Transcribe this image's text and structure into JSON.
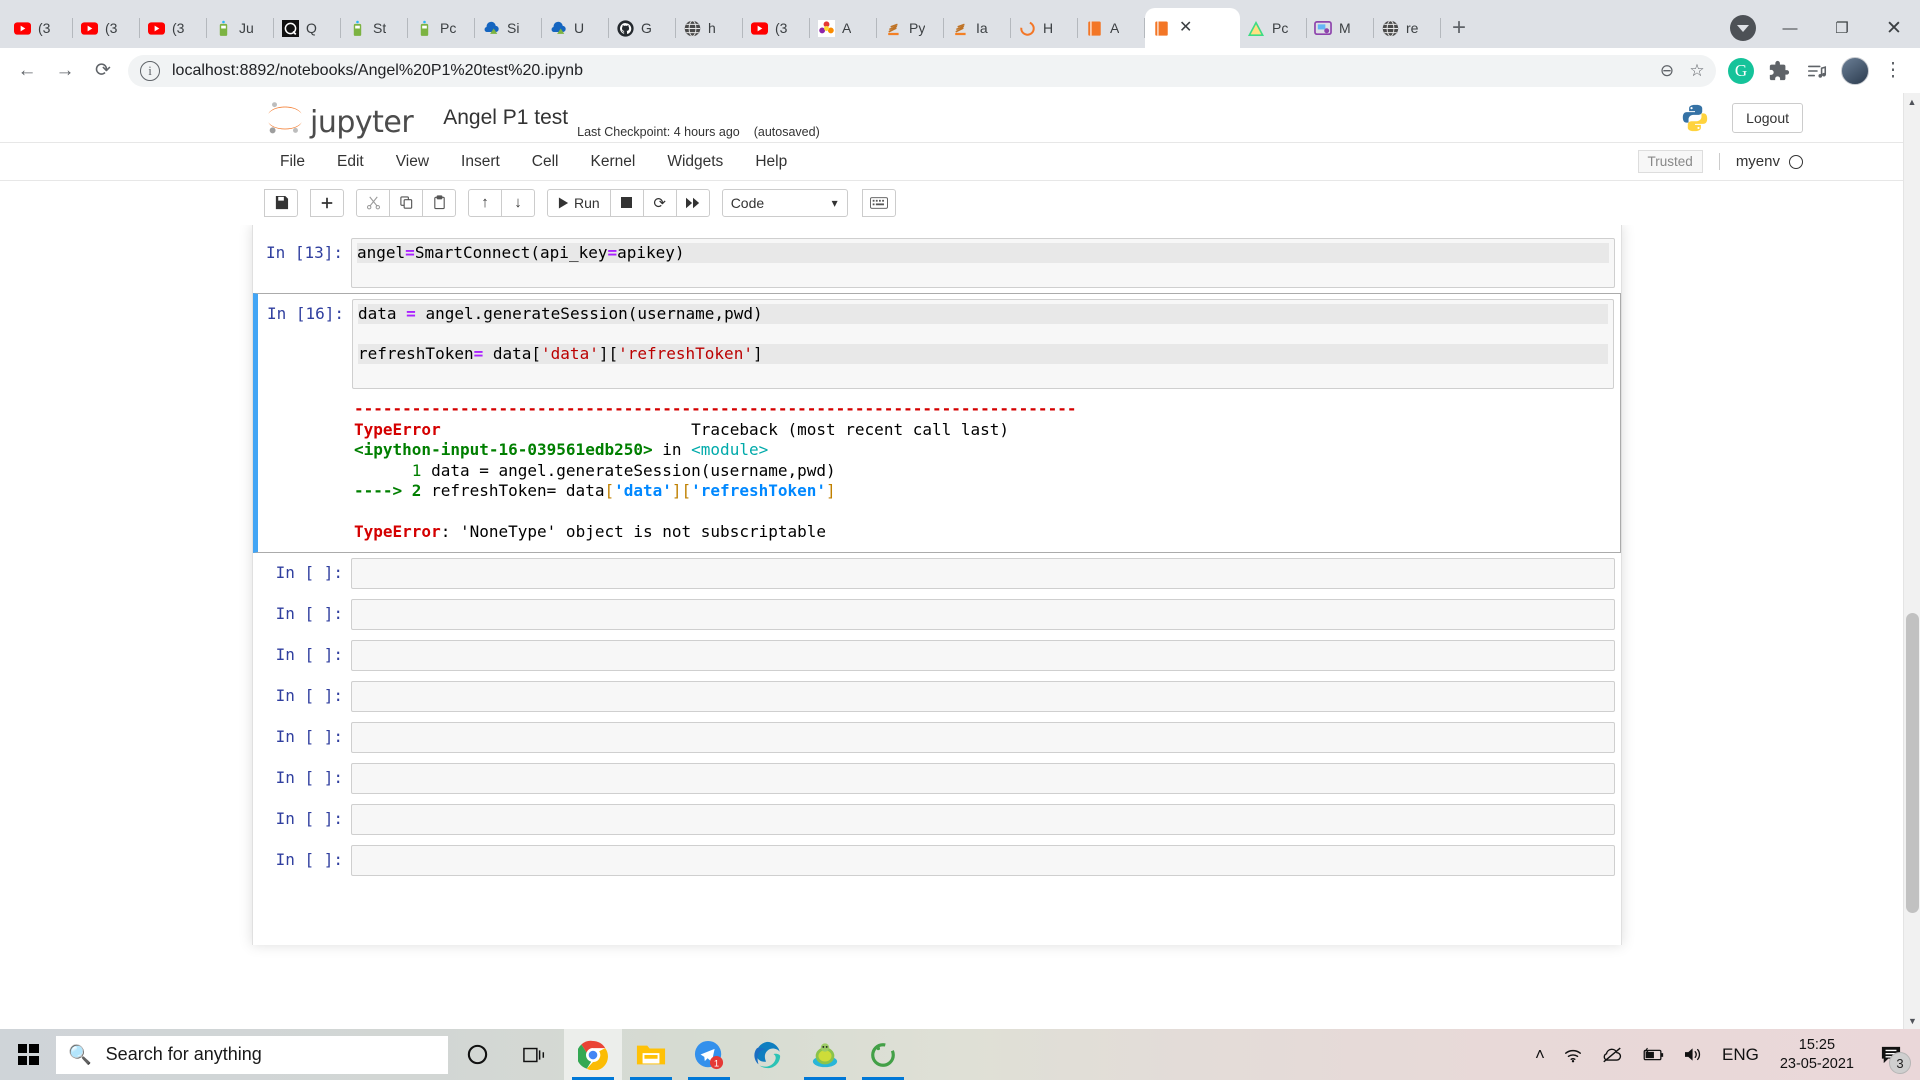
{
  "browser": {
    "tabs": [
      {
        "label": "(3",
        "icon": "youtube-icon",
        "type": "youtube",
        "active": false
      },
      {
        "label": "(3",
        "icon": "youtube-icon",
        "type": "youtube",
        "active": false
      },
      {
        "label": "(3",
        "icon": "youtube-icon",
        "type": "youtube",
        "active": false
      },
      {
        "label": "Ju",
        "icon": "jupyter-green-icon",
        "type": "green",
        "active": false
      },
      {
        "label": "Q",
        "icon": "dark-app-icon",
        "type": "dark",
        "active": false
      },
      {
        "label": "St",
        "icon": "jupyter-green-icon",
        "type": "green",
        "active": false
      },
      {
        "label": "Pc",
        "icon": "jupyter-green-icon",
        "type": "green",
        "active": false
      },
      {
        "label": "Si",
        "icon": "cloud-blue-icon",
        "type": "cloud",
        "active": false
      },
      {
        "label": "U",
        "icon": "cloud-blue-icon",
        "type": "cloud",
        "active": false
      },
      {
        "label": "G",
        "icon": "github-icon",
        "type": "github",
        "active": false
      },
      {
        "label": "h",
        "icon": "globe-icon",
        "type": "globe",
        "active": false
      },
      {
        "label": "(3",
        "icon": "youtube-icon",
        "type": "youtube",
        "active": false
      },
      {
        "label": "A",
        "icon": "flower-icon",
        "type": "flower",
        "active": false
      },
      {
        "label": "Py",
        "icon": "stack-orange-icon",
        "type": "stack",
        "active": false
      },
      {
        "label": "Ia",
        "icon": "stack-orange-icon",
        "type": "stack",
        "active": false
      },
      {
        "label": "H",
        "icon": "jupyter-ring-icon",
        "type": "ring",
        "active": false
      },
      {
        "label": "A",
        "icon": "notebook-orange-icon",
        "type": "book",
        "active": false
      },
      {
        "label": "",
        "icon": "notebook-orange-icon",
        "type": "book",
        "active": true,
        "close": "✕"
      },
      {
        "label": "Pc",
        "icon": "green-triangle-icon",
        "type": "triangle",
        "active": false
      },
      {
        "label": "M",
        "icon": "purple-monitor-icon",
        "type": "monitor",
        "active": false
      },
      {
        "label": "re",
        "icon": "globe-icon",
        "type": "globe",
        "active": false
      }
    ],
    "new_tab_label": "+",
    "window_controls": {
      "minimize": "—",
      "maximize": "❐",
      "close": "✕"
    },
    "nav": {
      "back": "←",
      "forward": "→",
      "reload": "⟳"
    },
    "address": {
      "info_icon": "i",
      "url": "localhost:8892/notebooks/Angel%20P1%20test%20.ipynb",
      "zoom_out_icon": "⊖",
      "bookmark_icon": "☆"
    },
    "toolbar_icons": {
      "grammarly": "G",
      "extensions": "puzzle-icon",
      "media": "media-icon",
      "profile": "avatar",
      "menu": "⋮"
    }
  },
  "jupyter": {
    "logo_word": "jupyter",
    "notebook_name": "Angel P1 test",
    "checkpoint": "Last Checkpoint: 4 hours ago",
    "autosaved": "(autosaved)",
    "logout_label": "Logout",
    "menu": [
      "File",
      "Edit",
      "View",
      "Insert",
      "Cell",
      "Kernel",
      "Widgets",
      "Help"
    ],
    "trusted_label": "Trusted",
    "kernel_label": "myenv",
    "toolbar": {
      "save": "💾",
      "insert": "➕",
      "cut": "✂",
      "copy": "⧉",
      "paste": "📋",
      "move_up": "↑",
      "move_down": "↓",
      "run_label": "Run",
      "stop": "■",
      "restart": "⟳",
      "restart_run_all": "⏩",
      "cell_type": "Code",
      "command_palette": "⌨"
    },
    "cells": [
      {
        "prompt": "In [13]:",
        "selected": false,
        "lines": [
          [
            {
              "t": "angel",
              "c": "plain"
            },
            {
              "t": "=",
              "c": "op"
            },
            {
              "t": "SmartConnect(api_key",
              "c": "plain"
            },
            {
              "t": "=",
              "c": "op"
            },
            {
              "t": "apikey)",
              "c": "plain"
            }
          ]
        ],
        "output": null
      },
      {
        "prompt": "In [16]:",
        "selected": true,
        "lines": [
          [
            {
              "t": "data ",
              "c": "plain"
            },
            {
              "t": "=",
              "c": "op"
            },
            {
              "t": " angel.generateSession(username,pwd)",
              "c": "plain"
            }
          ],
          [
            {
              "t": "refreshToken",
              "c": "plain"
            },
            {
              "t": "=",
              "c": "op"
            },
            {
              "t": " data[",
              "c": "plain"
            },
            {
              "t": "'data'",
              "c": "str"
            },
            {
              "t": "][",
              "c": "plain"
            },
            {
              "t": "'refreshToken'",
              "c": "str"
            },
            {
              "t": "]",
              "c": "plain"
            }
          ]
        ],
        "output": {
          "separator": "---------------------------------------------------------------------------",
          "error_name": "TypeError",
          "traceback_header": "Traceback (most recent call last)",
          "frame": "<ipython-input-16-039561edb250>",
          "frame_in": " in ",
          "frame_module": "<module>",
          "line1_num": "      1 ",
          "line1_code": "data = angel.generateSession(username,pwd)",
          "line2_arrow": "----> 2 ",
          "line2_code_pre": "refreshToken= data",
          "line2_key1": "'data'",
          "line2_key2": "'refreshToken'",
          "final_error_name": "TypeError",
          "final_error_msg": ": 'NoneType' object is not subscriptable"
        }
      },
      {
        "prompt": "In [ ]:",
        "selected": false,
        "lines": [],
        "output": null
      },
      {
        "prompt": "In [ ]:",
        "selected": false,
        "lines": [],
        "output": null
      },
      {
        "prompt": "In [ ]:",
        "selected": false,
        "lines": [],
        "output": null
      },
      {
        "prompt": "In [ ]:",
        "selected": false,
        "lines": [],
        "output": null
      },
      {
        "prompt": "In [ ]:",
        "selected": false,
        "lines": [],
        "output": null
      },
      {
        "prompt": "In [ ]:",
        "selected": false,
        "lines": [],
        "output": null
      },
      {
        "prompt": "In [ ]:",
        "selected": false,
        "lines": [],
        "output": null
      },
      {
        "prompt": "In [ ]:",
        "selected": false,
        "lines": [],
        "output": null
      }
    ]
  },
  "taskbar": {
    "start_icon": "windows-logo",
    "search_placeholder": "Search for anything",
    "cortana_icon": "cortana-circle-icon",
    "taskview_icon": "task-view-icon",
    "apps": [
      {
        "name": "chrome-taskbar-icon",
        "badge": null,
        "active": true
      },
      {
        "name": "file-explorer-taskbar-icon",
        "badge": null,
        "active": false
      },
      {
        "name": "telegram-taskbar-icon",
        "badge": "1",
        "active": false
      },
      {
        "name": "edge-taskbar-icon",
        "badge": null,
        "active": false
      },
      {
        "name": "turtle-app-taskbar-icon",
        "badge": null,
        "active": false
      },
      {
        "name": "green-ring-taskbar-icon",
        "badge": null,
        "active": false
      }
    ],
    "tray": {
      "chevron": "˄",
      "wifi_icon": "wifi-icon",
      "onedrive_icon": "onedrive-offline-icon",
      "battery_icon": "battery-charging-icon",
      "volume_icon": "volume-icon",
      "language": "ENG"
    },
    "clock": {
      "time": "15:25",
      "date": "23-05-2021"
    },
    "notification_count": "3"
  }
}
